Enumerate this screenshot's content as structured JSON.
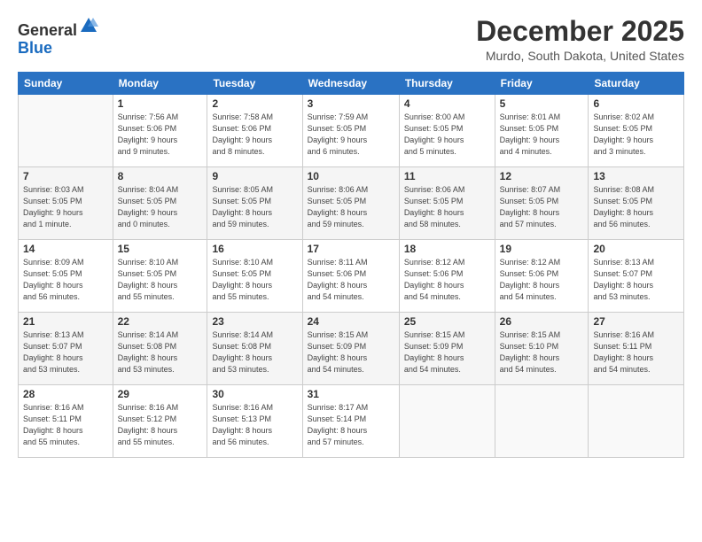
{
  "logo": {
    "general": "General",
    "blue": "Blue"
  },
  "title": "December 2025",
  "location": "Murdo, South Dakota, United States",
  "days_header": [
    "Sunday",
    "Monday",
    "Tuesday",
    "Wednesday",
    "Thursday",
    "Friday",
    "Saturday"
  ],
  "weeks": [
    [
      {
        "num": "",
        "sunrise": "",
        "sunset": "",
        "daylight": ""
      },
      {
        "num": "1",
        "sunrise": "Sunrise: 7:56 AM",
        "sunset": "Sunset: 5:06 PM",
        "daylight": "Daylight: 9 hours and 9 minutes."
      },
      {
        "num": "2",
        "sunrise": "Sunrise: 7:58 AM",
        "sunset": "Sunset: 5:06 PM",
        "daylight": "Daylight: 9 hours and 8 minutes."
      },
      {
        "num": "3",
        "sunrise": "Sunrise: 7:59 AM",
        "sunset": "Sunset: 5:05 PM",
        "daylight": "Daylight: 9 hours and 6 minutes."
      },
      {
        "num": "4",
        "sunrise": "Sunrise: 8:00 AM",
        "sunset": "Sunset: 5:05 PM",
        "daylight": "Daylight: 9 hours and 5 minutes."
      },
      {
        "num": "5",
        "sunrise": "Sunrise: 8:01 AM",
        "sunset": "Sunset: 5:05 PM",
        "daylight": "Daylight: 9 hours and 4 minutes."
      },
      {
        "num": "6",
        "sunrise": "Sunrise: 8:02 AM",
        "sunset": "Sunset: 5:05 PM",
        "daylight": "Daylight: 9 hours and 3 minutes."
      }
    ],
    [
      {
        "num": "7",
        "sunrise": "Sunrise: 8:03 AM",
        "sunset": "Sunset: 5:05 PM",
        "daylight": "Daylight: 9 hours and 1 minute."
      },
      {
        "num": "8",
        "sunrise": "Sunrise: 8:04 AM",
        "sunset": "Sunset: 5:05 PM",
        "daylight": "Daylight: 9 hours and 0 minutes."
      },
      {
        "num": "9",
        "sunrise": "Sunrise: 8:05 AM",
        "sunset": "Sunset: 5:05 PM",
        "daylight": "Daylight: 8 hours and 59 minutes."
      },
      {
        "num": "10",
        "sunrise": "Sunrise: 8:06 AM",
        "sunset": "Sunset: 5:05 PM",
        "daylight": "Daylight: 8 hours and 59 minutes."
      },
      {
        "num": "11",
        "sunrise": "Sunrise: 8:06 AM",
        "sunset": "Sunset: 5:05 PM",
        "daylight": "Daylight: 8 hours and 58 minutes."
      },
      {
        "num": "12",
        "sunrise": "Sunrise: 8:07 AM",
        "sunset": "Sunset: 5:05 PM",
        "daylight": "Daylight: 8 hours and 57 minutes."
      },
      {
        "num": "13",
        "sunrise": "Sunrise: 8:08 AM",
        "sunset": "Sunset: 5:05 PM",
        "daylight": "Daylight: 8 hours and 56 minutes."
      }
    ],
    [
      {
        "num": "14",
        "sunrise": "Sunrise: 8:09 AM",
        "sunset": "Sunset: 5:05 PM",
        "daylight": "Daylight: 8 hours and 56 minutes."
      },
      {
        "num": "15",
        "sunrise": "Sunrise: 8:10 AM",
        "sunset": "Sunset: 5:05 PM",
        "daylight": "Daylight: 8 hours and 55 minutes."
      },
      {
        "num": "16",
        "sunrise": "Sunrise: 8:10 AM",
        "sunset": "Sunset: 5:05 PM",
        "daylight": "Daylight: 8 hours and 55 minutes."
      },
      {
        "num": "17",
        "sunrise": "Sunrise: 8:11 AM",
        "sunset": "Sunset: 5:06 PM",
        "daylight": "Daylight: 8 hours and 54 minutes."
      },
      {
        "num": "18",
        "sunrise": "Sunrise: 8:12 AM",
        "sunset": "Sunset: 5:06 PM",
        "daylight": "Daylight: 8 hours and 54 minutes."
      },
      {
        "num": "19",
        "sunrise": "Sunrise: 8:12 AM",
        "sunset": "Sunset: 5:06 PM",
        "daylight": "Daylight: 8 hours and 54 minutes."
      },
      {
        "num": "20",
        "sunrise": "Sunrise: 8:13 AM",
        "sunset": "Sunset: 5:07 PM",
        "daylight": "Daylight: 8 hours and 53 minutes."
      }
    ],
    [
      {
        "num": "21",
        "sunrise": "Sunrise: 8:13 AM",
        "sunset": "Sunset: 5:07 PM",
        "daylight": "Daylight: 8 hours and 53 minutes."
      },
      {
        "num": "22",
        "sunrise": "Sunrise: 8:14 AM",
        "sunset": "Sunset: 5:08 PM",
        "daylight": "Daylight: 8 hours and 53 minutes."
      },
      {
        "num": "23",
        "sunrise": "Sunrise: 8:14 AM",
        "sunset": "Sunset: 5:08 PM",
        "daylight": "Daylight: 8 hours and 53 minutes."
      },
      {
        "num": "24",
        "sunrise": "Sunrise: 8:15 AM",
        "sunset": "Sunset: 5:09 PM",
        "daylight": "Daylight: 8 hours and 54 minutes."
      },
      {
        "num": "25",
        "sunrise": "Sunrise: 8:15 AM",
        "sunset": "Sunset: 5:09 PM",
        "daylight": "Daylight: 8 hours and 54 minutes."
      },
      {
        "num": "26",
        "sunrise": "Sunrise: 8:15 AM",
        "sunset": "Sunset: 5:10 PM",
        "daylight": "Daylight: 8 hours and 54 minutes."
      },
      {
        "num": "27",
        "sunrise": "Sunrise: 8:16 AM",
        "sunset": "Sunset: 5:11 PM",
        "daylight": "Daylight: 8 hours and 54 minutes."
      }
    ],
    [
      {
        "num": "28",
        "sunrise": "Sunrise: 8:16 AM",
        "sunset": "Sunset: 5:11 PM",
        "daylight": "Daylight: 8 hours and 55 minutes."
      },
      {
        "num": "29",
        "sunrise": "Sunrise: 8:16 AM",
        "sunset": "Sunset: 5:12 PM",
        "daylight": "Daylight: 8 hours and 55 minutes."
      },
      {
        "num": "30",
        "sunrise": "Sunrise: 8:16 AM",
        "sunset": "Sunset: 5:13 PM",
        "daylight": "Daylight: 8 hours and 56 minutes."
      },
      {
        "num": "31",
        "sunrise": "Sunrise: 8:17 AM",
        "sunset": "Sunset: 5:14 PM",
        "daylight": "Daylight: 8 hours and 57 minutes."
      },
      {
        "num": "",
        "sunrise": "",
        "sunset": "",
        "daylight": ""
      },
      {
        "num": "",
        "sunrise": "",
        "sunset": "",
        "daylight": ""
      },
      {
        "num": "",
        "sunrise": "",
        "sunset": "",
        "daylight": ""
      }
    ]
  ]
}
